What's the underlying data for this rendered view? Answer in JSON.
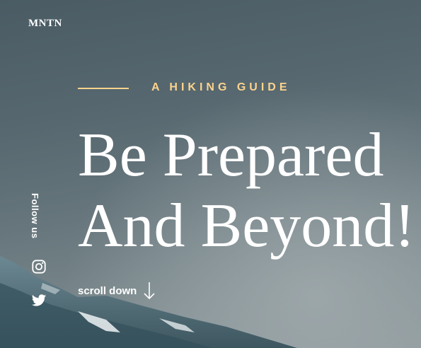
{
  "brand": {
    "logo": "MNTN"
  },
  "hero": {
    "eyebrow": "A HIKING GUIDE",
    "title_line1": "Be Prepared",
    "title_line2": "And Beyond!",
    "scroll_label": "scroll down"
  },
  "social": {
    "label": "Follow us",
    "links": [
      {
        "icon": "instagram-icon"
      },
      {
        "icon": "twitter-icon"
      }
    ]
  },
  "colors": {
    "accent": "#fbd38d",
    "text": "#ffffff",
    "sky": "#56676f"
  }
}
